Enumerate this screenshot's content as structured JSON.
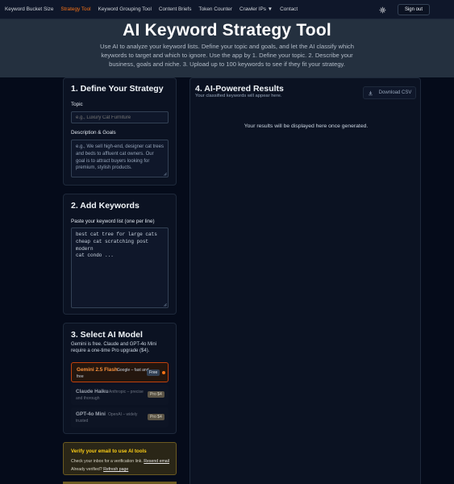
{
  "nav": {
    "links": [
      "Keyword Bucket Size",
      "Strategy Tool",
      "Keyword Grouping Tool",
      "Content Briefs",
      "Token Counter",
      "Crawler IPs ▼",
      "Contact"
    ],
    "active_index": 1,
    "sign_out": "Sign out"
  },
  "hero": {
    "title": "AI Keyword Strategy Tool",
    "subtitle": "Use AI to analyze your keyword lists. Define your topic and goals, and let the AI classify which keywords to target and which to ignore. Use the app by 1. Define your topic. 2. Describe your business, goals and niche. 3. Upload up to 100 keywords to see if they fit your strategy."
  },
  "strategy": {
    "title": "1. Define Your Strategy",
    "topic_label": "Topic",
    "topic_placeholder": "e.g., Luxury Cat Furniture",
    "desc_label": "Description & Goals",
    "desc_placeholder": "e.g., We sell high-end, designer cat trees and beds to affluent cat owners. Our goal is to attract buyers looking for premium, stylish products."
  },
  "keywords": {
    "title": "2. Add Keywords",
    "list_label": "Paste your keyword list (one per line)",
    "list_placeholder": "best cat tree for large cats\ncheap cat scratching post modern\ncat condo ..."
  },
  "model": {
    "title": "3. Select AI Model",
    "subtitle": "Gemini is free. Claude and GPT-4o Mini require a one-time Pro upgrade ($4).",
    "options": [
      {
        "name": "Gemini 2.5 Flash",
        "desc": "Google – fast and free",
        "badge": "Free",
        "selected": true
      },
      {
        "name": "Claude Haiku",
        "desc": "Anthropic – precise and thorough",
        "badge": "Pro $4",
        "selected": false
      },
      {
        "name": "GPT-4o Mini",
        "desc": "OpenAI – widely trusted",
        "badge": "Pro $4",
        "selected": false
      }
    ]
  },
  "verify": {
    "title": "Verify your email to use AI tools",
    "line1": "Check your inbox for a verification link.",
    "resend": "Resend email",
    "line2": "Already verified?",
    "refresh": "Refresh page"
  },
  "results": {
    "title": "4. AI-Powered Results",
    "subtitle": "Your classified keywords will appear here.",
    "download": "Download CSV",
    "empty": "Your results will be displayed here once generated."
  },
  "colors": {
    "accent": "#f97316",
    "background": "#050b1a",
    "card": "#0b1222",
    "warning": "#facc15"
  }
}
